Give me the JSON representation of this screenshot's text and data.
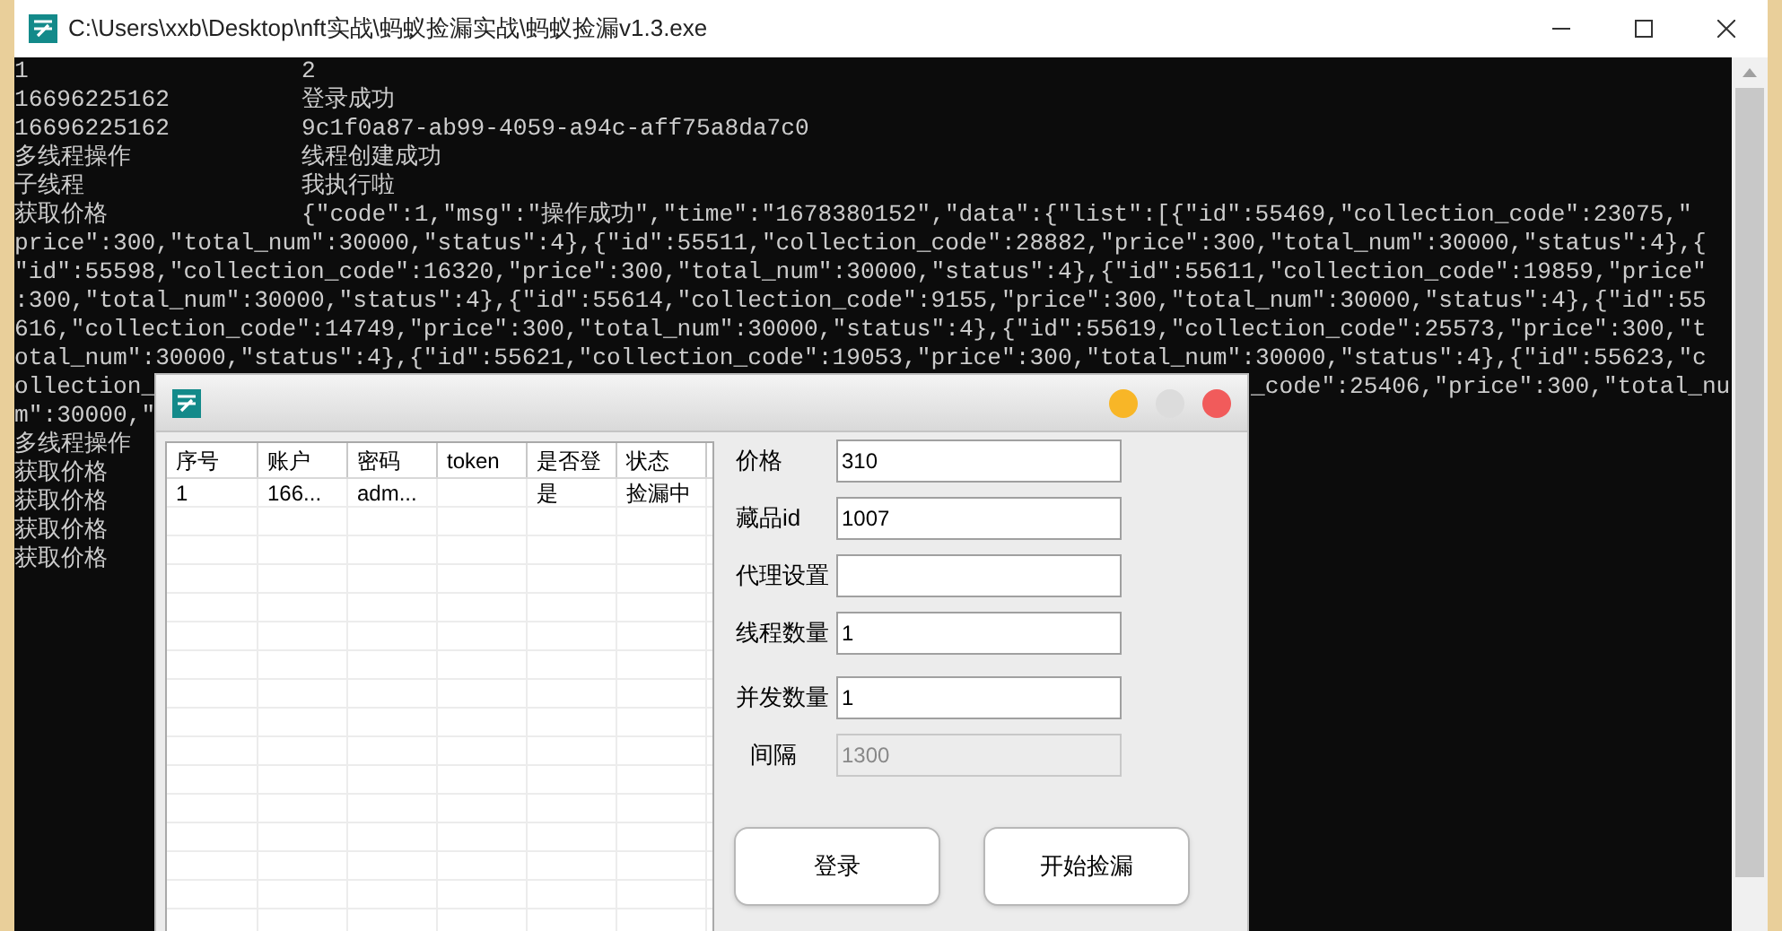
{
  "console_window": {
    "title": "C:\\Users\\xxb\\Desktop\\nft实战\\蚂蚁捡漏实战\\蚂蚁捡漏v1.3.exe"
  },
  "console": {
    "lines": [
      {
        "kind": "pair",
        "key": "1",
        "value": "2"
      },
      {
        "kind": "pair",
        "key": "16696225162",
        "value": "登录成功"
      },
      {
        "kind": "pair",
        "key": "16696225162",
        "value": "9c1f0a87-ab99-4059-a94c-aff75a8da7c0"
      },
      {
        "kind": "pair",
        "key": "多线程操作",
        "value": "线程创建成功"
      },
      {
        "kind": "pair",
        "key": "子线程",
        "value": "我执行啦"
      },
      {
        "kind": "pair",
        "key": "获取价格",
        "value": "{\"code\":1,\"msg\":\"操作成功\",\"time\":\"1678380152\",\"data\":{\"list\":[{\"id\":55469,\"collection_code\":23075,\""
      },
      {
        "kind": "text",
        "text": "price\":300,\"total_num\":30000,\"status\":4},{\"id\":55511,\"collection_code\":28882,\"price\":300,\"total_num\":30000,\"status\":4},{"
      },
      {
        "kind": "text",
        "text": "\"id\":55598,\"collection_code\":16320,\"price\":300,\"total_num\":30000,\"status\":4},{\"id\":55611,\"collection_code\":19859,\"price\""
      },
      {
        "kind": "text",
        "text": ":300,\"total_num\":30000,\"status\":4},{\"id\":55614,\"collection_code\":9155,\"price\":300,\"total_num\":30000,\"status\":4},{\"id\":55"
      },
      {
        "kind": "text",
        "text": "616,\"collection_code\":14749,\"price\":300,\"total_num\":30000,\"status\":4},{\"id\":55619,\"collection_code\":25573,\"price\":300,\"t"
      },
      {
        "kind": "text",
        "text": "otal_num\":30000,\"status\":4},{\"id\":55621,\"collection_code\":19053,\"price\":300,\"total_num\":30000,\"status\":4},{\"id\":55623,\"c"
      },
      {
        "kind": "split",
        "text": "ollection_",
        "after": "_code\":25406,\"price\":300,\"total_nu"
      },
      {
        "kind": "split",
        "text": "m\":30000,\""
      },
      {
        "kind": "split",
        "text": "多线程操作"
      },
      {
        "kind": "split",
        "text": "获取价格"
      },
      {
        "kind": "split",
        "text": "获取价格"
      },
      {
        "kind": "split",
        "text": "获取价格"
      },
      {
        "kind": "split",
        "text": "获取价格"
      }
    ]
  },
  "dialog": {
    "table": {
      "columns": [
        "序号",
        "账户",
        "密码",
        "token",
        "是否登",
        "状态"
      ],
      "rows": [
        [
          "1",
          "166...",
          "adm...",
          "",
          "是",
          "捡漏中"
        ]
      ]
    },
    "fields": [
      {
        "label": "价格",
        "value": "310",
        "disabled": false
      },
      {
        "label": "藏品id",
        "value": "1007",
        "disabled": false
      },
      {
        "label": "代理设置",
        "disabled": false
      },
      {
        "label": "线程数量",
        "value": "1",
        "disabled": false
      },
      {
        "label": "并发数量",
        "value": "1",
        "disabled": false
      },
      {
        "label": "间隔",
        "value": "1300",
        "disabled": true
      }
    ],
    "buttons": [
      "登录",
      "开始捡漏"
    ]
  }
}
